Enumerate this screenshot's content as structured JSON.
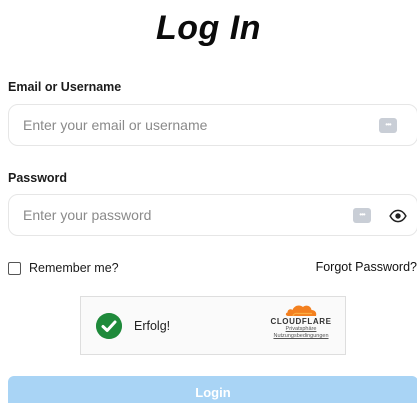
{
  "header": {
    "title": "Log In"
  },
  "form": {
    "email": {
      "label": "Email or Username",
      "placeholder": "Enter your email or username",
      "value": ""
    },
    "password": {
      "label": "Password",
      "placeholder": "Enter your password",
      "value": ""
    },
    "remember": {
      "label": "Remember me?",
      "checked": false
    },
    "forgot_label": "Forgot Password?",
    "submit_label": "Login"
  },
  "captcha": {
    "status": "Erfolg!",
    "brand": "CLOUDFLARE",
    "privacy_link": "Privatsphäre",
    "terms_link": "Nutzungsbedingungen",
    "colors": {
      "success": "#1f8a3b",
      "brand": "#f38020"
    }
  },
  "icons": {
    "password_manager": "password-manager-icon",
    "show_password": "eye-icon",
    "success": "checkmark-circle-icon",
    "brand_logo": "cloudflare-cloud-icon"
  },
  "colors": {
    "submit_background": "#a9d4f5",
    "text": "#111111"
  }
}
